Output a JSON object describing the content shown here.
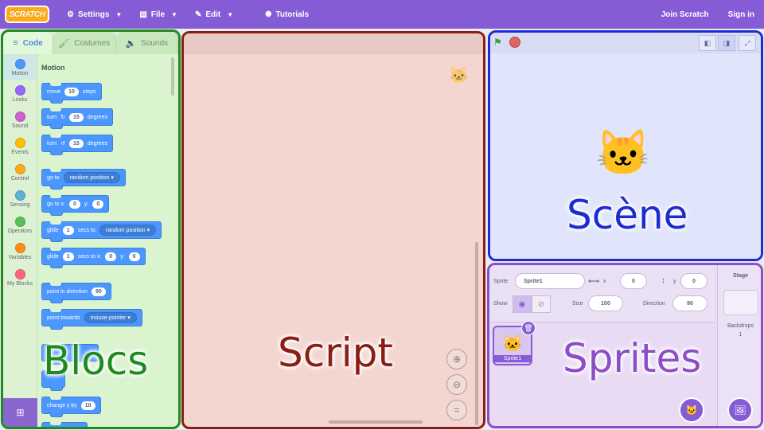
{
  "menubar": {
    "logo": "SCRATCH",
    "items": [
      {
        "label": "Settings",
        "icon": "gear-icon"
      },
      {
        "label": "File",
        "icon": "file-icon"
      },
      {
        "label": "Edit",
        "icon": "pencil-icon"
      },
      {
        "label": "Tutorials",
        "icon": "lightbulb-icon"
      }
    ],
    "join": "Join Scratch",
    "signin": "Sign in"
  },
  "tabs": [
    {
      "label": "Code",
      "icon": "code-icon"
    },
    {
      "label": "Costumes",
      "icon": "brush-icon"
    },
    {
      "label": "Sounds",
      "icon": "speaker-icon"
    }
  ],
  "categories": [
    {
      "label": "Motion",
      "color": "#4c97ff"
    },
    {
      "label": "Looks",
      "color": "#9966ff"
    },
    {
      "label": "Sound",
      "color": "#cf63cf"
    },
    {
      "label": "Events",
      "color": "#ffbf00"
    },
    {
      "label": "Control",
      "color": "#ffab19"
    },
    {
      "label": "Sensing",
      "color": "#5cb1d6"
    },
    {
      "label": "Operators",
      "color": "#59c059"
    },
    {
      "label": "Variables",
      "color": "#ff8c1a"
    },
    {
      "label": "My Blocks",
      "color": "#ff6680"
    }
  ],
  "palette": {
    "title": "Motion",
    "blocks": {
      "move": {
        "t1": "move",
        "v1": "10",
        "t2": "steps"
      },
      "turn_right": {
        "t1": "turn",
        "glyph": "↻",
        "v1": "15",
        "t2": "degrees"
      },
      "turn_left": {
        "t1": "turn",
        "glyph": "↺",
        "v1": "15",
        "t2": "degrees"
      },
      "goto": {
        "t1": "go to",
        "dd": "random position ▾"
      },
      "gotoxy": {
        "t1": "go to x:",
        "v1": "0",
        "t2": "y:",
        "v2": "0"
      },
      "glide1": {
        "t1": "glide",
        "v1": "1",
        "t2": "secs to",
        "dd": "random position ▾"
      },
      "glide2": {
        "t1": "glide",
        "v1": "1",
        "t2": "secs to x:",
        "v2": "0",
        "t3": "y:",
        "v3": "0"
      },
      "point": {
        "t1": "point in direction",
        "v1": "90"
      },
      "towards": {
        "t1": "point towards",
        "dd": "mouse-pointer ▾"
      },
      "changey": {
        "t1": "change y by",
        "v1": "10"
      }
    }
  },
  "stage": {
    "flag_icon": "green-flag-icon",
    "stop_icon": "stop-icon"
  },
  "sprite_info": {
    "sprite_label": "Sprite",
    "sprite_name": "Sprite1",
    "x_label": "x",
    "x_value": "0",
    "y_label": "y",
    "y_value": "0",
    "show_label": "Show",
    "size_label": "Size",
    "size_value": "100",
    "direction_label": "Direction",
    "direction_value": "90",
    "tile_name": "Sprite1"
  },
  "stage_column": {
    "title": "Stage",
    "backdrops_label": "Backdrops",
    "backdrops_count": "1"
  },
  "overlay_labels": {
    "blocs": "Blocs",
    "script": "Script",
    "scene": "Scène",
    "sprites": "Sprites"
  },
  "colors": {
    "menubar": "#855cd6",
    "blocs": "#1f8b1f",
    "script": "#8b1e14",
    "scene": "#1d2bd3",
    "sprites": "#8c4ec8",
    "motion_block": "#4c97ff"
  }
}
